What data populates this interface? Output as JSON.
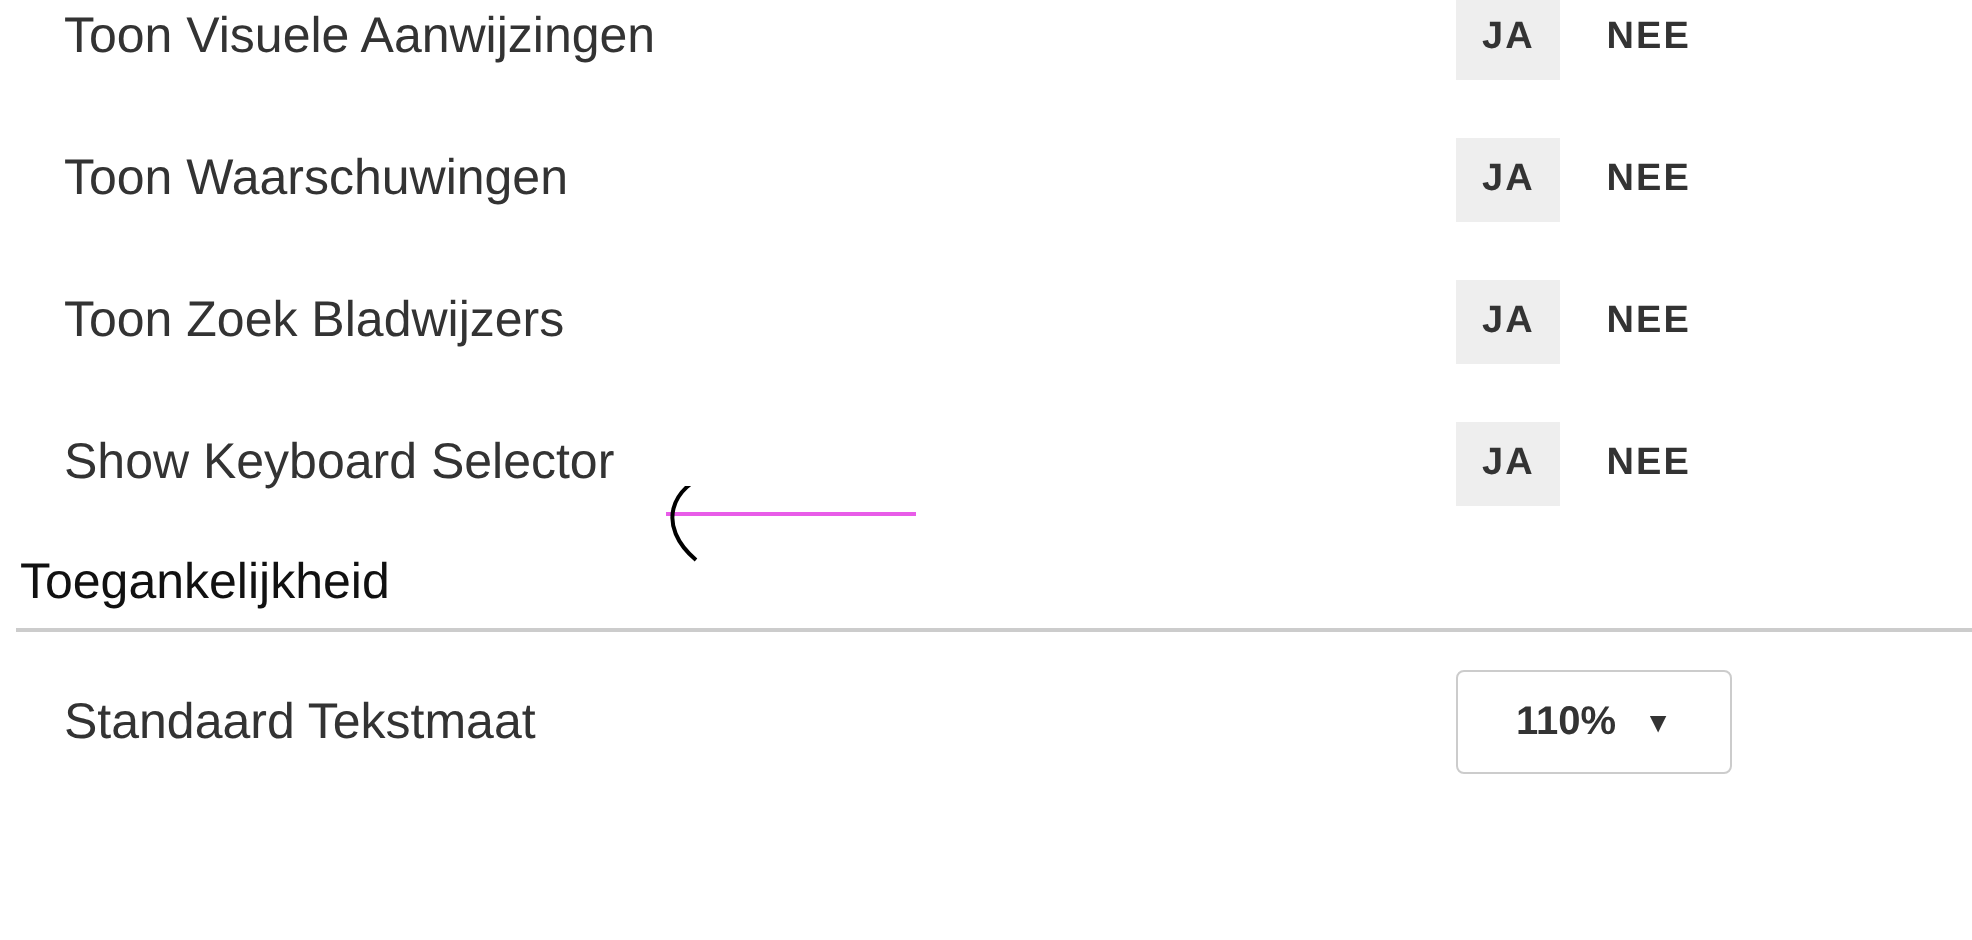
{
  "settings": [
    {
      "label": "Toon Visuele Aanwijzingen",
      "options": [
        {
          "label": "JA",
          "selected": true
        },
        {
          "label": "NEE",
          "selected": false
        }
      ]
    },
    {
      "label": "Toon Waarschuwingen",
      "options": [
        {
          "label": "JA",
          "selected": true
        },
        {
          "label": "NEE",
          "selected": false
        }
      ]
    },
    {
      "label": "Toon Zoek Bladwijzers",
      "options": [
        {
          "label": "JA",
          "selected": true
        },
        {
          "label": "NEE",
          "selected": false
        }
      ]
    },
    {
      "label": "Show Keyboard Selector",
      "options": [
        {
          "label": "JA",
          "selected": true
        },
        {
          "label": "NEE",
          "selected": false
        }
      ]
    }
  ],
  "section": {
    "title": "Toegankelijkheid",
    "rows": [
      {
        "label": "Standaard Tekstmaat",
        "value": "110%",
        "caret": "▼"
      }
    ]
  }
}
